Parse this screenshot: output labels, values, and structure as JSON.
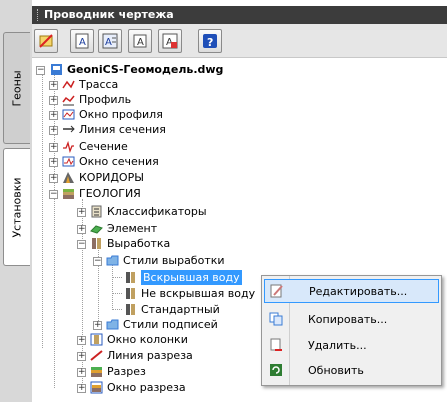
{
  "panel": {
    "title": "Проводник чертежа",
    "tabs": [
      "Геоны",
      "Установки"
    ]
  },
  "toolbar": {
    "buttons": [
      "delete-text-icon",
      "text-a-icon",
      "text-a-list-icon",
      "text-a-outline-icon",
      "text-a-red-icon",
      "help-icon"
    ]
  },
  "tree": {
    "root": "GeoniCS-Геомодель.dwg",
    "items": {
      "trassa": "Трасса",
      "profil": "Профиль",
      "okno_profilya": "Окно профиля",
      "liniya_secheniya": "Линия сечения",
      "sechenie": "Сечение",
      "okno_secheniya": "Окно сечения",
      "koridory": "КОРИДОРЫ",
      "geologiya": "ГЕОЛОГИЯ",
      "klassifikatory": "Классификаторы",
      "element": "Элемент",
      "vyrabotka": "Выработка",
      "stili_vyrabotki": "Стили выработки",
      "vskryvshaya": "Вскрывшая воду",
      "ne_vskryvshaya": "Не вскрывшая воду",
      "standartnyy": "Стандартный",
      "stili_podpisey": "Стили подписей",
      "okno_kolonki": "Окно колонки",
      "liniya_razreza": "Линия разреза",
      "razrez": "Разрез",
      "okno_razreza": "Окно разреза"
    }
  },
  "context_menu": {
    "edit": "Редактировать...",
    "copy": "Копировать...",
    "delete": "Удалить...",
    "refresh": "Обновить"
  }
}
